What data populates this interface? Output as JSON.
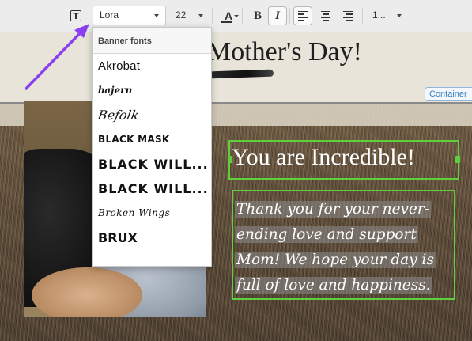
{
  "toolbar": {
    "text_tool_glyph": "T",
    "font_family_value": "Lora",
    "font_size_value": "22",
    "text_color_glyph": "A",
    "bold_glyph": "B",
    "italic_glyph": "I",
    "line_spacing_value": "1..."
  },
  "font_dropdown": {
    "header": "Banner fonts",
    "items": [
      "Akrobat",
      "bajern",
      "Befolk",
      "BLACK MASK",
      "BLACK WILL...",
      "BLACK WILL...",
      "Broken Wings",
      "BRUX",
      ""
    ]
  },
  "banner": {
    "title": "Mother's Day!",
    "container_label": "Container"
  },
  "card": {
    "headline": "You are Incredible!",
    "body": "Thank you for your never-ending love and support Mom! We hope your day is full of love and happiness."
  },
  "colors": {
    "selection_outline": "#5fcf3e",
    "annotation_arrow": "#8a3ff0",
    "container_tag": "#3a7fc1"
  }
}
